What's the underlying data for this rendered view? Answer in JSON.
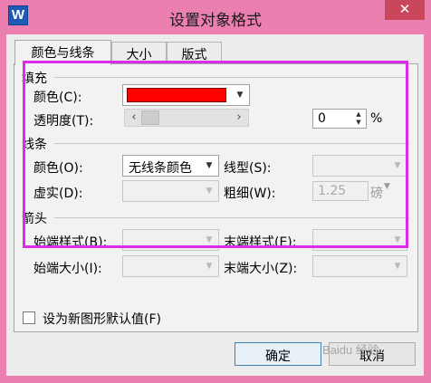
{
  "window": {
    "title": "设置对象格式",
    "app_icon_letter": "W",
    "close_glyph": "✕"
  },
  "tabs": [
    {
      "label": "颜色与线条",
      "active": true
    },
    {
      "label": "大小",
      "active": false
    },
    {
      "label": "版式",
      "active": false
    }
  ],
  "fill": {
    "section_title": "填充",
    "color_label": "颜色(C):",
    "color_value": "#ff0000",
    "transparency_label": "透明度(T):",
    "transparency_value": "0",
    "transparency_unit": "%"
  },
  "line": {
    "section_title": "线条",
    "color_label": "颜色(O):",
    "color_value": "无线条颜色",
    "type_label": "线型(S):",
    "type_value": "",
    "dash_label": "虚实(D):",
    "dash_value": "",
    "weight_label": "粗细(W):",
    "weight_value": "1.25",
    "weight_unit": "磅"
  },
  "arrows": {
    "section_title": "箭头",
    "begin_style_label": "始端样式(B):",
    "end_style_label": "末端样式(E):",
    "begin_size_label": "始端大小(I):",
    "end_size_label": "末端大小(Z):"
  },
  "default_checkbox": {
    "label": "设为新图形默认值(F)",
    "checked": false
  },
  "buttons": {
    "ok_label": "确定",
    "cancel_label": "取消"
  },
  "watermark": "Baidu 经验",
  "highlight_color": "#dd2ce6"
}
